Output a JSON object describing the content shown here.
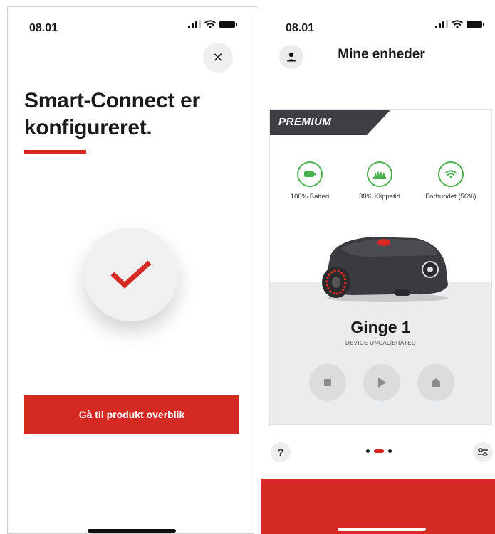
{
  "left_screen": {
    "status_time": "08.01",
    "close_symbol": "✕",
    "title_line1": "Smart-Connect er",
    "title_line2": "konfigureret.",
    "cta_label": "Gå til produkt overblik"
  },
  "right_screen": {
    "status_time": "08.01",
    "title": "Mine enheder",
    "badge": "PREMIUM",
    "stats": [
      {
        "label": "100%  Batteri",
        "icon": "battery-icon"
      },
      {
        "label": "38%  Klippetid",
        "icon": "grass-icon"
      },
      {
        "label": "Forbundet (56%)",
        "icon": "wifi-icon"
      }
    ],
    "device_name": "Ginge 1",
    "device_status": "DEVICE UNCALIBRATED",
    "help_label": "?",
    "pager": {
      "total": 3,
      "active": 2
    }
  },
  "colors": {
    "accent_red": "#d42a23",
    "status_green": "#4caf50",
    "badge_dark": "#3d3f44"
  }
}
